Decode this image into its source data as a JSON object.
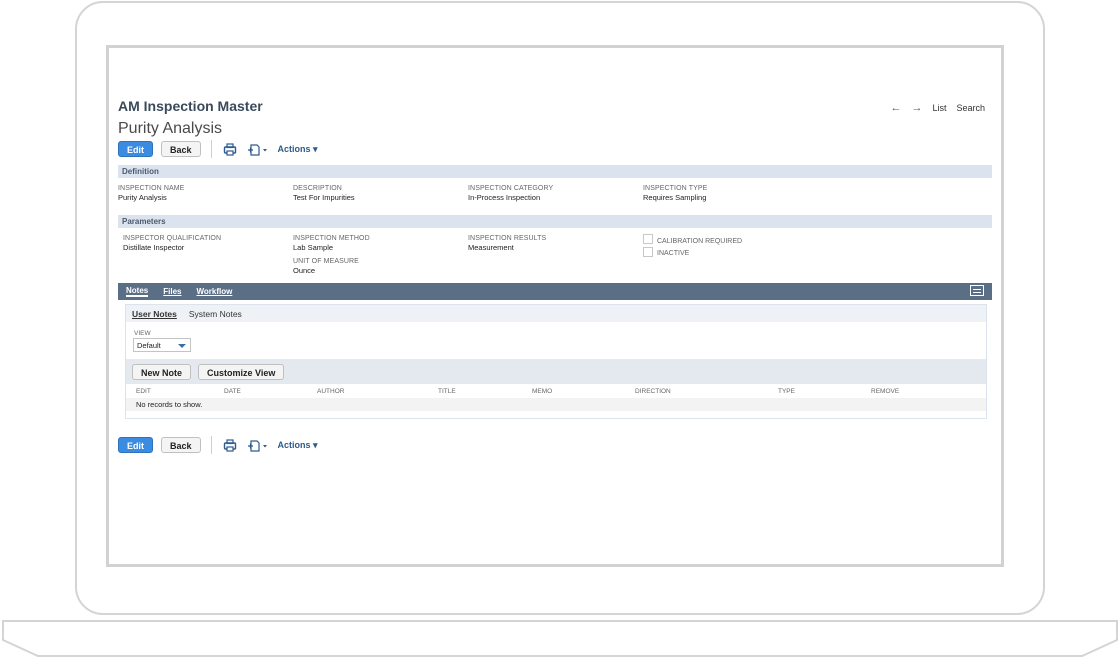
{
  "record": {
    "type": "AM Inspection Master",
    "name": "Purity Analysis"
  },
  "nav": {
    "list": "List",
    "search": "Search"
  },
  "toolbar": {
    "edit": "Edit",
    "back": "Back",
    "actions": "Actions ▾"
  },
  "definition": {
    "header": "Definition",
    "fields": [
      {
        "label": "INSPECTION NAME",
        "value": "Purity Analysis"
      },
      {
        "label": "DESCRIPTION",
        "value": "Test For Impurities"
      },
      {
        "label": "INSPECTION CATEGORY",
        "value": "In-Process Inspection"
      },
      {
        "label": "INSPECTION TYPE",
        "value": "Requires Sampling"
      }
    ]
  },
  "parameters": {
    "header": "Parameters",
    "fields": [
      {
        "label": "INSPECTOR QUALIFICATION",
        "value": "Distillate Inspector"
      },
      {
        "label": "INSPECTION METHOD",
        "value": "Lab Sample"
      },
      {
        "label": "UNIT OF MEASURE",
        "value": "Ounce"
      },
      {
        "label": "INSPECTION RESULTS",
        "value": "Measurement"
      }
    ],
    "checkboxes": [
      {
        "label": "CALIBRATION REQUIRED",
        "checked": false
      },
      {
        "label": "INACTIVE",
        "checked": false
      }
    ]
  },
  "tabs": [
    "Notes",
    "Files",
    "Workflow"
  ],
  "subtabs": [
    "User Notes",
    "System Notes"
  ],
  "notes": {
    "view_label": "VIEW",
    "view_value": "Default",
    "new_note": "New Note",
    "customize_view": "Customize View",
    "columns": [
      "EDIT",
      "DATE",
      "AUTHOR",
      "TITLE",
      "MEMO",
      "DIRECTION",
      "TYPE",
      "REMOVE"
    ],
    "empty_text": "No records to show."
  },
  "colors": {
    "primary_button": "#3b8be0",
    "tab_bar": "#5a6e86",
    "section_header": "#dbe3ef",
    "title": "#3a4a5c"
  }
}
